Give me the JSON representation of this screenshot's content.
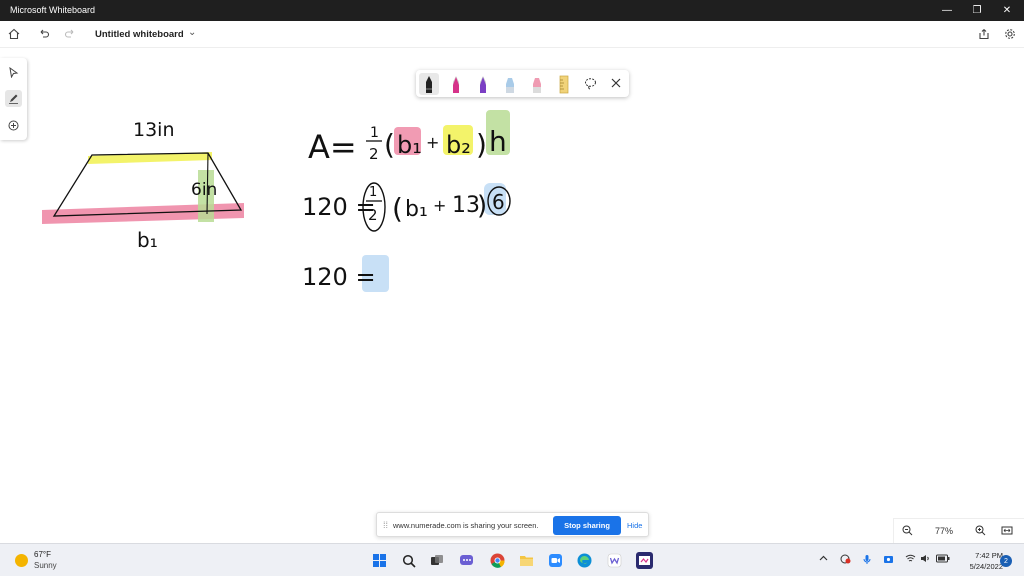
{
  "window": {
    "title": "Microsoft Whiteboard",
    "minimize": "—",
    "restore": "❐",
    "close": "✕"
  },
  "appbar": {
    "board_name": "Untitled whiteboard"
  },
  "canvas": {
    "labels": {
      "top": "13in",
      "height": "6in",
      "bottom": "b₁"
    },
    "eq1": {
      "lhs": "A=",
      "half_num": "1",
      "half_den": "2",
      "b1": "b₁",
      "plus": "+",
      "b2": "b₂",
      "h": "h"
    },
    "eq2": {
      "lhs": "120 =",
      "half_num": "1",
      "half_den": "2",
      "b1": "b₁",
      "plus": "+",
      "thirteen": "13",
      "six": "6"
    },
    "eq3": {
      "lhs": "120 ="
    }
  },
  "share_bar": {
    "message": "www.numerade.com is sharing your screen.",
    "stop": "Stop sharing",
    "hide": "Hide"
  },
  "zoom": {
    "level": "77%"
  },
  "taskbar": {
    "weather_temp": "67°F",
    "weather_desc": "Sunny",
    "time": "7:42 PM",
    "date": "5/24/2022",
    "notifications": "2"
  },
  "colors": {
    "highlight_yellow": "#f2f25a",
    "highlight_pink": "#ee8aa6",
    "highlight_green": "#b9dc94",
    "highlight_blue": "#c2ddf5",
    "accent": "#1a73e8"
  }
}
